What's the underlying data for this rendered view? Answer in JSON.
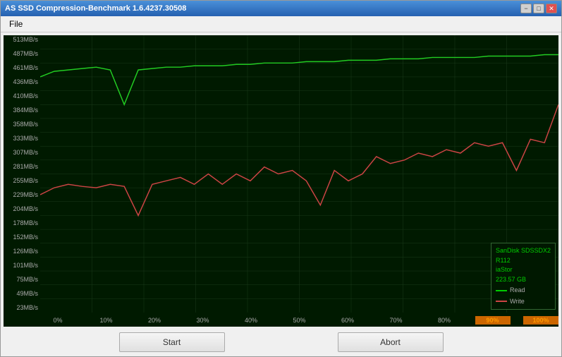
{
  "window": {
    "title": "AS SSD Compression-Benchmark 1.6.4237.30508",
    "min_label": "−",
    "max_label": "□",
    "close_label": "✕"
  },
  "menu": {
    "file_label": "File"
  },
  "chart": {
    "y_labels": [
      "513MB/s",
      "487MB/s",
      "461MB/s",
      "436MB/s",
      "410MB/s",
      "384MB/s",
      "358MB/s",
      "333MB/s",
      "307MB/s",
      "281MB/s",
      "255MB/s",
      "229MB/s",
      "204MB/s",
      "178MB/s",
      "152MB/s",
      "126MB/s",
      "101MB/s",
      "75MB/s",
      "49MB/s",
      "23MB/s"
    ],
    "x_labels": [
      "0%",
      "10%",
      "20%",
      "30%",
      "40%",
      "50%",
      "60%",
      "70%",
      "80%",
      "90%",
      "100%"
    ],
    "grid_color": "#1a3a1a",
    "bg_color": "#001a00"
  },
  "legend": {
    "device": "SanDisk SDSSDX2",
    "model": "R112",
    "driver": "iaStor",
    "size": "223.57 GB",
    "read_label": "Read",
    "write_label": "Write"
  },
  "highlight": {
    "label": "90% 100%"
  },
  "buttons": {
    "start_label": "Start",
    "abort_label": "Abort"
  }
}
